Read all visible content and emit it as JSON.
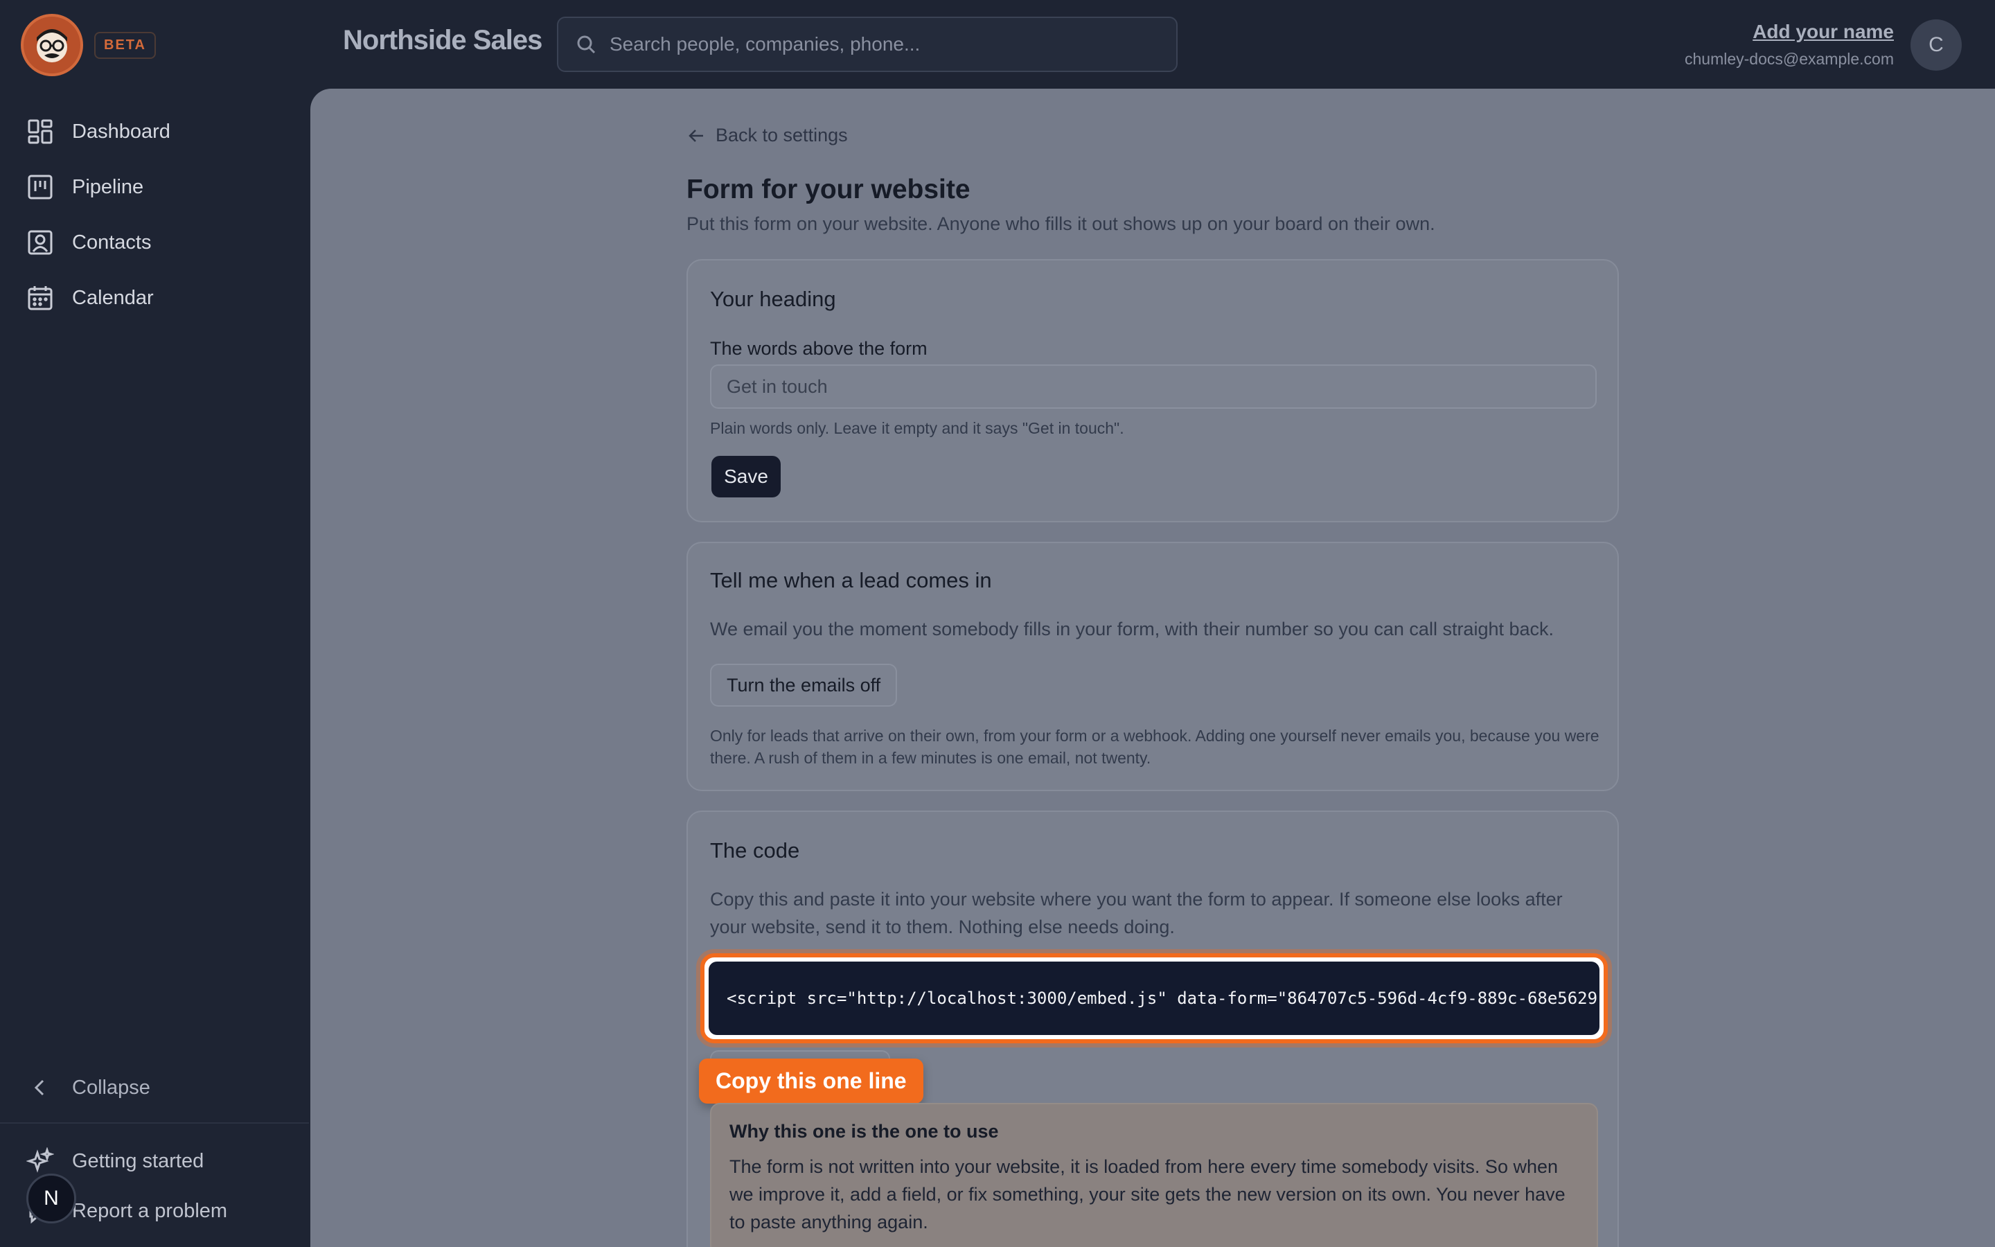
{
  "app": {
    "badge": "BETA",
    "brand": "Northside Sales"
  },
  "search": {
    "placeholder": "Search people, companies, phone..."
  },
  "user": {
    "name": "Add your name",
    "email": "chumley-docs@example.com",
    "avatar_initial": "C"
  },
  "sidebar": {
    "items": [
      {
        "label": "Dashboard",
        "icon": "dashboard-icon"
      },
      {
        "label": "Pipeline",
        "icon": "pipeline-icon"
      },
      {
        "label": "Contacts",
        "icon": "contacts-icon"
      },
      {
        "label": "Calendar",
        "icon": "calendar-icon"
      }
    ],
    "collapse_label": "Collapse",
    "getting_started_label": "Getting started",
    "report_label": "Report a problem",
    "n_badge": "N"
  },
  "page": {
    "back_label": "Back to settings",
    "title": "Form for your website",
    "subtitle": "Put this form on your website. Anyone who fills it out shows up on your board on their own."
  },
  "heading_card": {
    "title": "Your heading",
    "field_label": "The words above the form",
    "input_placeholder": "Get in touch",
    "hint": "Plain words only. Leave it empty and it says \"Get in touch\".",
    "save_label": "Save"
  },
  "notify_card": {
    "title": "Tell me when a lead comes in",
    "description": "We email you the moment somebody fills in your form, with their number so you can call straight back.",
    "button_label": "Turn the emails off",
    "hint": "Only for leads that arrive on their own, from your form or a webhook. Adding one yourself never emails you, because you were there. A rush of them in a few minutes is one email, not twenty."
  },
  "code_card": {
    "title": "The code",
    "description": "Copy this and paste it into your website where you want the form to appear. If someone else looks after your website, send it to them. Nothing else needs doing.",
    "snippet": "<script src=\"http://localhost:3000/embed.js\" data-form=\"864707c5-596d-4cf9-889c-68e5629",
    "tooltip": "Copy this one line",
    "why_title": "Why this one is the one to use",
    "why_text": "The form is not written into your website, it is loaded from here every time somebody visits. So when we improve it, add a field, or fix something, your site gets the new version on its own. You never have to paste anything again."
  },
  "colors": {
    "accent": "#f26b1d",
    "sidebar_bg": "#1e2433",
    "main_bg": "#757b8a",
    "dark_button": "#161b2c"
  }
}
